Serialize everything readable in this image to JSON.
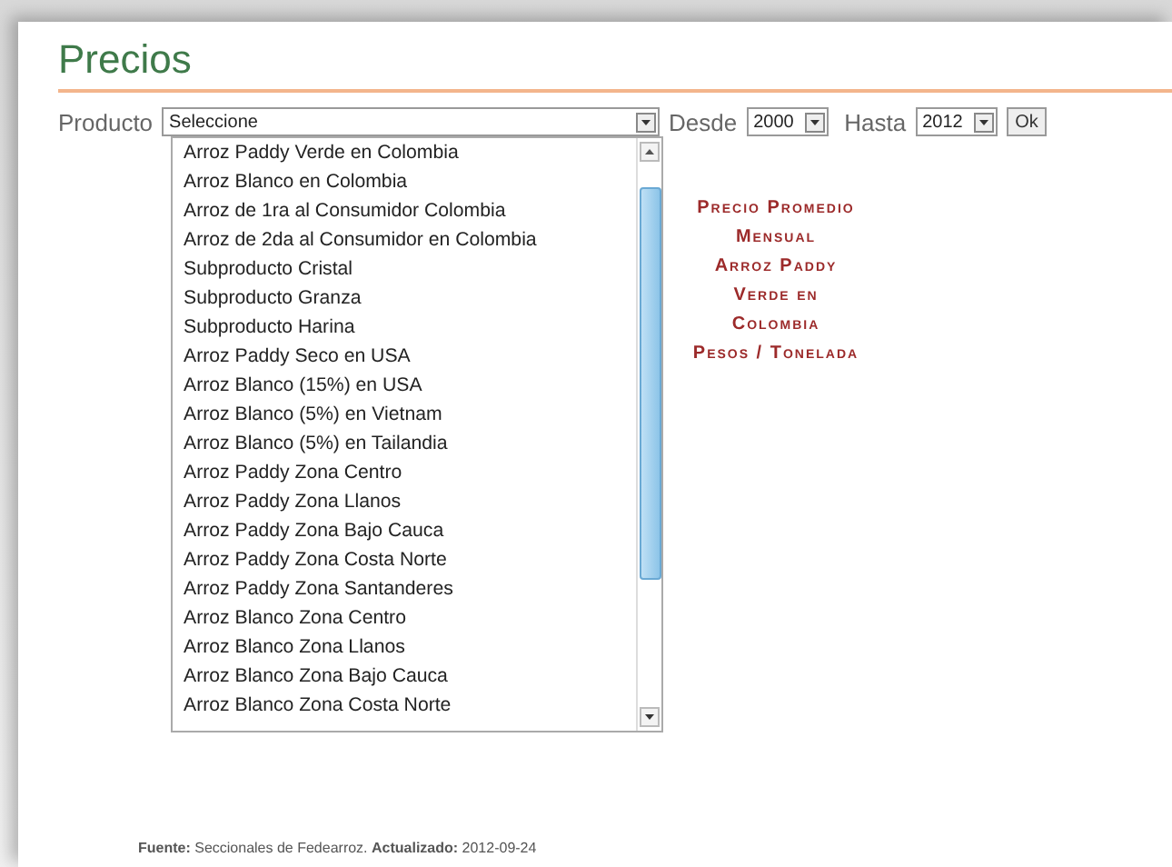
{
  "title": "Precios",
  "filters": {
    "product_label": "Producto",
    "product_value": "Seleccione",
    "from_label": "Desde",
    "from_value": "2000",
    "to_label": "Hasta",
    "to_value": "2012",
    "ok_button": "Ok"
  },
  "product_options": [
    {
      "label": "Arroz Paddy Verde en Colombia",
      "selected": false
    },
    {
      "label": "Arroz Blanco en Colombia",
      "selected": false
    },
    {
      "label": "Arroz de 1ra al Consumidor Colombia",
      "selected": false
    },
    {
      "label": "Arroz de 2da al Consumidor en Colombia",
      "selected": false
    },
    {
      "label": "Subproducto Cristal",
      "selected": false
    },
    {
      "label": "Subproducto Granza",
      "selected": false
    },
    {
      "label": "Subproducto Harina",
      "selected": false
    },
    {
      "label": "Arroz Paddy Seco en USA",
      "selected": false
    },
    {
      "label": "Arroz Blanco (15%) en USA",
      "selected": false
    },
    {
      "label": "Arroz Blanco (5%) en Vietnam",
      "selected": false
    },
    {
      "label": "Arroz Blanco (5%) en Tailandia",
      "selected": false
    },
    {
      "label": "Arroz Paddy Zona Centro",
      "selected": false
    },
    {
      "label": "Arroz Paddy Zona Llanos",
      "selected": false
    },
    {
      "label": "Arroz Paddy Zona Bajo Cauca",
      "selected": false
    },
    {
      "label": "Arroz Paddy Zona Costa Norte",
      "selected": false
    },
    {
      "label": "Arroz Paddy Zona Santanderes",
      "selected": false
    },
    {
      "label": "Arroz Blanco Zona Centro",
      "selected": false
    },
    {
      "label": "Arroz Blanco Zona Llanos",
      "selected": false
    },
    {
      "label": "Arroz Blanco Zona Bajo Cauca",
      "selected": false
    },
    {
      "label": "Arroz Blanco Zona Costa Norte",
      "selected": false
    }
  ],
  "chart_title": [
    "Precio Promedio",
    "Mensual",
    "Arroz Paddy",
    "Verde en",
    "Colombia",
    "Pesos / Tonelada"
  ],
  "footer": "**Fuente:** Seccionales de Fedearroz. **Actualizado:** 2012-09-24"
}
